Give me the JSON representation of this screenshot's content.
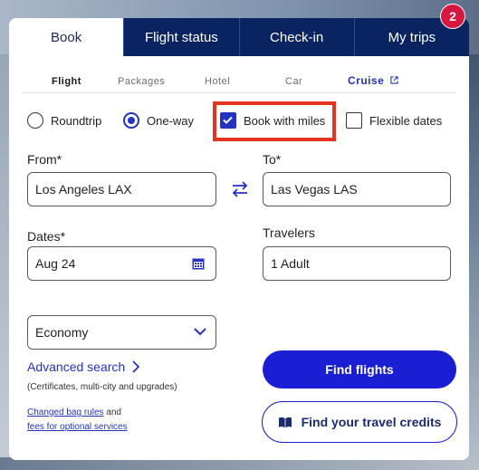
{
  "tabs": [
    {
      "label": "Book",
      "active": true
    },
    {
      "label": "Flight status",
      "active": false
    },
    {
      "label": "Check-in",
      "active": false
    },
    {
      "label": "My trips",
      "active": false
    }
  ],
  "badge": {
    "count": "2",
    "color": "#d6173f"
  },
  "subtabs": [
    {
      "label": "Flight",
      "active": true
    },
    {
      "label": "Packages",
      "active": false
    },
    {
      "label": "Hotel",
      "active": false
    },
    {
      "label": "Car",
      "active": false
    },
    {
      "label": "Cruise",
      "active": false,
      "icon": "external-link-icon"
    }
  ],
  "trip_type": {
    "roundtrip_label": "Roundtrip",
    "roundtrip_selected": false,
    "oneway_label": "One-way",
    "oneway_selected": true
  },
  "options": {
    "book_with_miles_label": "Book with miles",
    "book_with_miles_checked": true,
    "flexible_dates_label": "Flexible dates",
    "flexible_dates_checked": false
  },
  "form": {
    "from_label": "From*",
    "from_value": "Los Angeles LAX",
    "to_label": "To*",
    "to_value": "Las Vegas LAS",
    "dates_label": "Dates*",
    "dates_value": "Aug 24",
    "travelers_label": "Travelers",
    "travelers_value": "1 Adult",
    "cabin_value": "Economy"
  },
  "advanced": {
    "label": "Advanced search",
    "sub": "(Certificates, multi-city and upgrades)"
  },
  "links": {
    "bag_rules": "Changed bag rules",
    "and": "and",
    "fees": "fees for optional services"
  },
  "buttons": {
    "find_flights": "Find flights",
    "travel_credits": "Find your travel credits"
  },
  "colors": {
    "accent": "#2432c4",
    "primary_button": "#1b1fd4",
    "tab_bg": "#0a2461",
    "highlight": "#e3341f"
  }
}
